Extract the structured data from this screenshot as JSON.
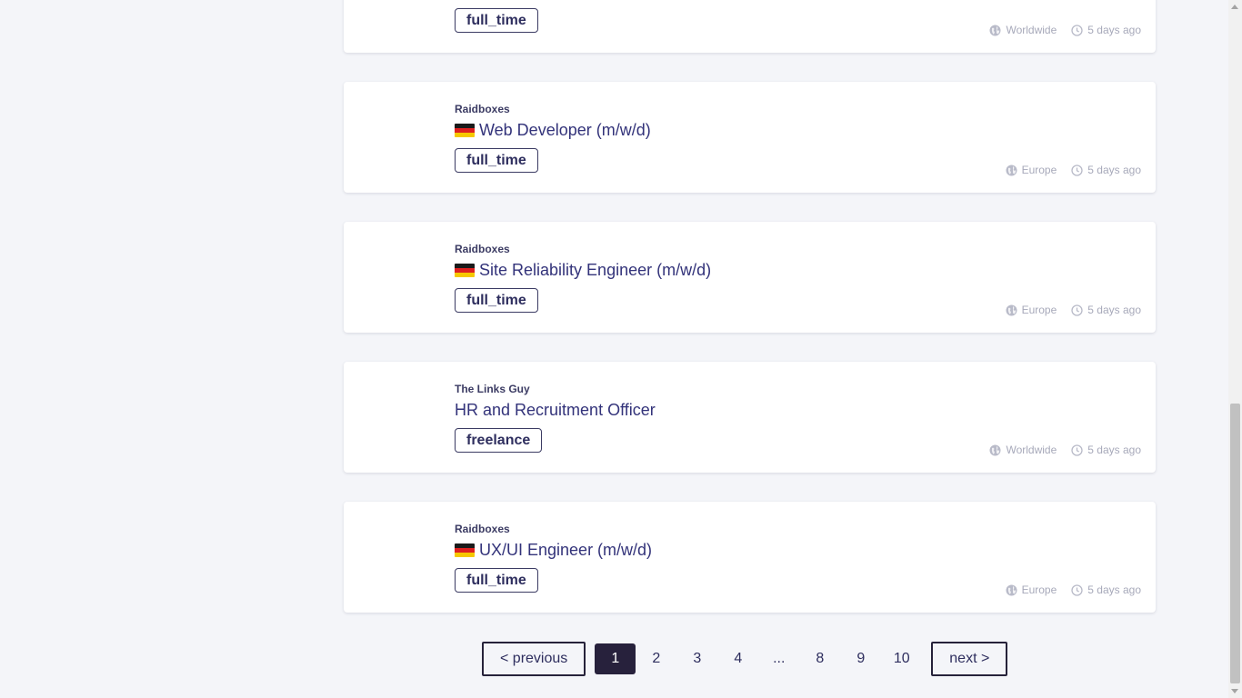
{
  "jobs": [
    {
      "company": "",
      "title": "",
      "flag": "",
      "type": "full_time",
      "location": "Worldwide",
      "posted": "5 days ago"
    },
    {
      "company": "Raidboxes",
      "title": "Web Developer (m/w/d)",
      "flag": "de",
      "type": "full_time",
      "location": "Europe",
      "posted": "5 days ago"
    },
    {
      "company": "Raidboxes",
      "title": "Site Reliability Engineer (m/w/d)",
      "flag": "de",
      "type": "full_time",
      "location": "Europe",
      "posted": "5 days ago"
    },
    {
      "company": "The Links Guy",
      "title": "HR and Recruitment Officer",
      "flag": "",
      "type": "freelance",
      "location": "Worldwide",
      "posted": "5 days ago"
    },
    {
      "company": "Raidboxes",
      "title": "UX/UI Engineer (m/w/d)",
      "flag": "de",
      "type": "full_time",
      "location": "Europe",
      "posted": "5 days ago"
    }
  ],
  "pagination": {
    "previous": "< previous",
    "next": "next >",
    "pages": [
      "1",
      "2",
      "3",
      "4",
      "...",
      "8",
      "9",
      "10"
    ],
    "current": "1"
  },
  "colors": {
    "accent": "#27213c",
    "title": "#33337a",
    "meta": "#a7a9ba",
    "background": "#f4f5f9"
  },
  "icons": {
    "location": "globe-icon",
    "time": "clock-icon",
    "flag_de": "german-flag-icon"
  }
}
